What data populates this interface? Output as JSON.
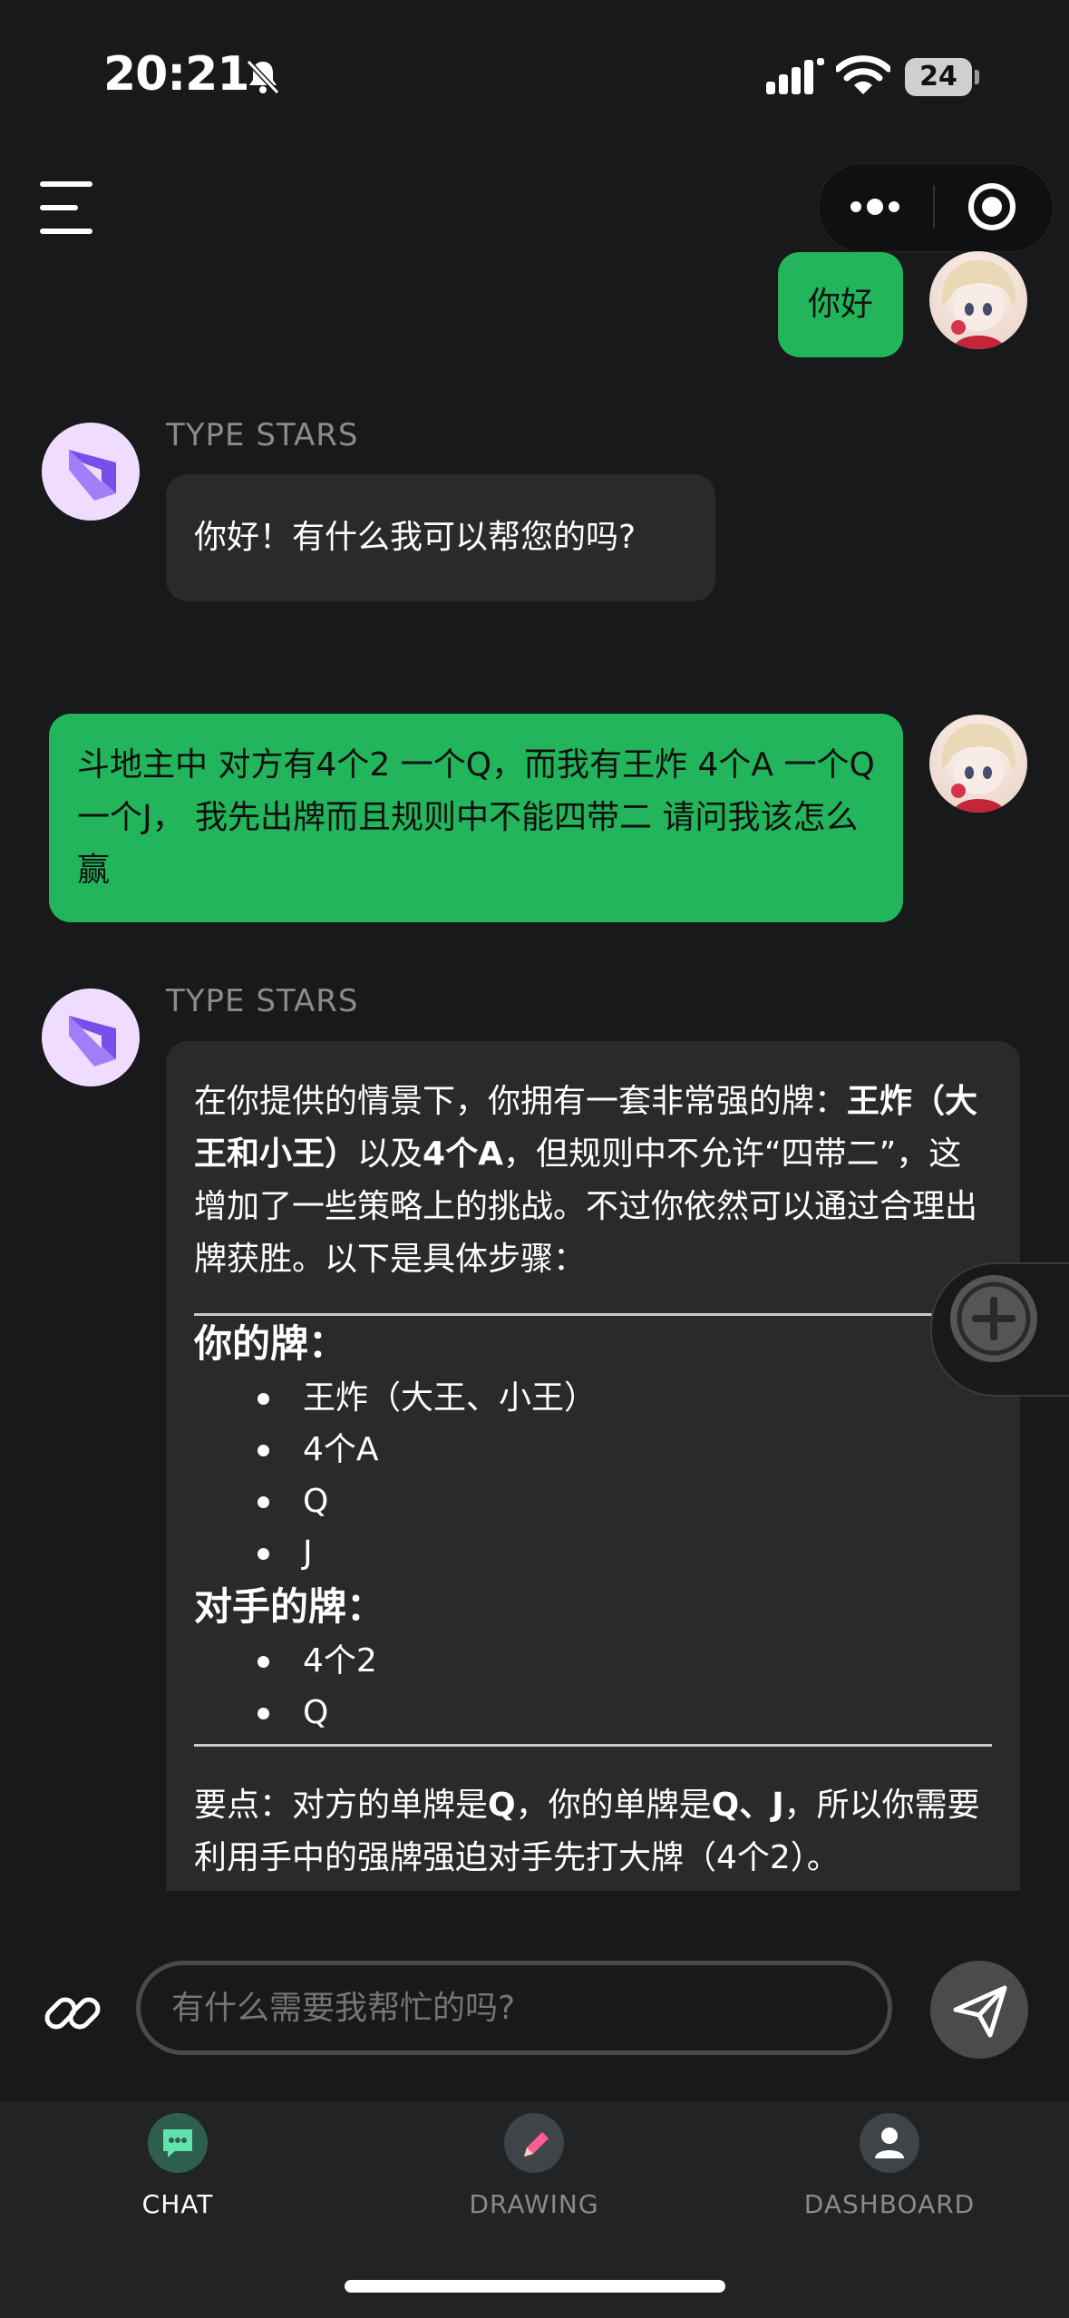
{
  "status_bar": {
    "time": "20:21",
    "battery": "24"
  },
  "header": {
    "menu_icon": "hamburger-menu-icon",
    "more_icon": "more-dots-icon",
    "close_icon": "target-circle-icon"
  },
  "messages": [
    {
      "role": "user",
      "text": "你好"
    },
    {
      "role": "bot",
      "sender": "TYPE STARS",
      "text": "你好！有什么我可以帮您的吗?"
    },
    {
      "role": "user",
      "text": "斗地主中 对方有4个2 一个Q，而我有王炸 4个A 一个Q 一个J， 我先出牌而且规则中不能四带二 请问我该怎么赢"
    },
    {
      "role": "bot",
      "sender": "TYPE STARS",
      "intro_pre": "在你提供的情景下，你拥有一套非常强的牌：",
      "intro_b1": "王炸（大王和小王）",
      "intro_mid": "以及",
      "intro_b2": "4个A",
      "intro_post": "，但规则中不允许“四带二”，这增加了一些策略上的挑战。不过你依然可以通过合理出牌获胜。以下是具体步骤：",
      "your_cards_title": "你的牌：",
      "your_cards": [
        "王炸（大王、小王）",
        "4个A",
        "Q",
        "J"
      ],
      "opponent_cards_title": "对手的牌：",
      "opponent_cards": [
        "4个2",
        "Q"
      ],
      "key_label": "要点：对方的单牌是",
      "key_b1": "Q",
      "key_mid": "，你的单牌是",
      "key_b2": "Q、J",
      "key_post": "，所以你需要利用手中的强牌强迫对手先打大牌（4个2）。"
    }
  ],
  "composer": {
    "placeholder": "有什么需要我帮忙的吗?",
    "attach_icon": "paperclip-icon",
    "send_icon": "paper-plane-icon"
  },
  "tabs": [
    {
      "label": "CHAT",
      "icon": "chat-bubble-icon",
      "active": true
    },
    {
      "label": "DRAWING",
      "icon": "pencil-icon",
      "active": false
    },
    {
      "label": "DASHBOARD",
      "icon": "user-icon",
      "active": false
    }
  ],
  "colors": {
    "background": "#18191a",
    "user_bubble": "#23b55b",
    "bot_bubble": "#2a2a2b",
    "bot_avatar_bg": "#efdcff",
    "accent_purple": "#8a5cf6"
  }
}
